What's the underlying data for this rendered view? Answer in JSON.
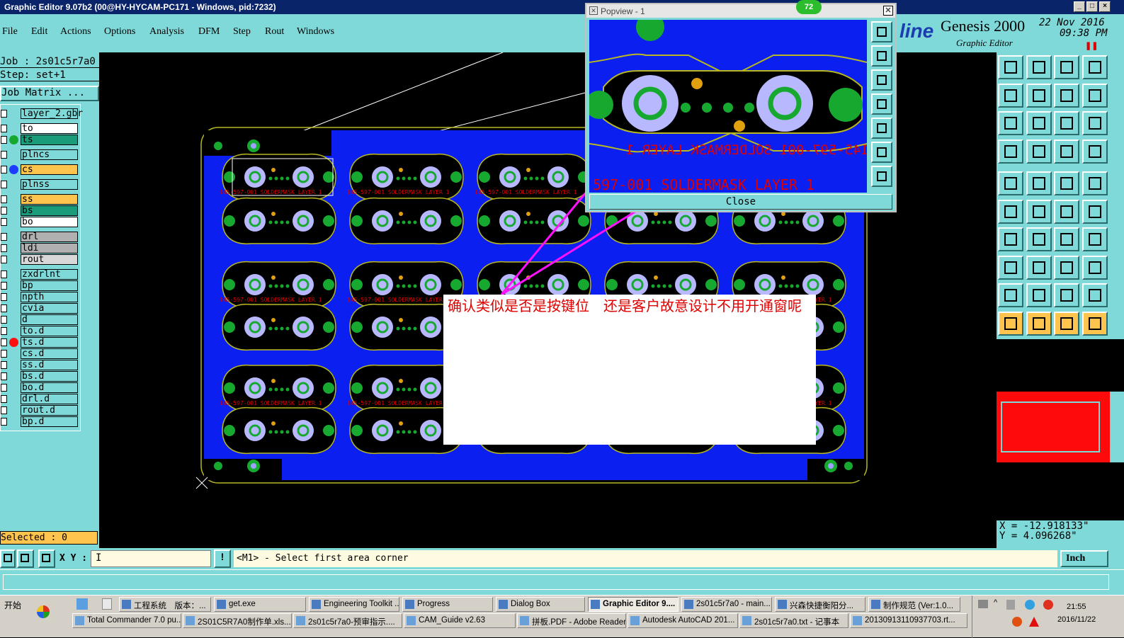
{
  "window": {
    "title": "Graphic Editor 9.07b2 (00@HY-HYCAM-PC171 - Windows, pid:7232)",
    "min": "_",
    "max": "□",
    "close": "×"
  },
  "menu": [
    "File",
    "Edit",
    "Actions",
    "Options",
    "Analysis",
    "DFM",
    "Step",
    "Rout",
    "Windows"
  ],
  "brand": {
    "logo": "line",
    "product": "Genesis 2000",
    "subtitle": "Graphic Editor",
    "date": "22 Nov 2016",
    "time": "09:38 PM"
  },
  "job": {
    "job_line": "Job : 2s01c5r7a0",
    "step_line": "Step: set+1",
    "matrix_button": "Job Matrix ..."
  },
  "layers": [
    {
      "name": "layer_2.gbr",
      "bg": "#7fd9d9",
      "dot": ""
    },
    {
      "name": "to",
      "bg": "#ffffff",
      "dot": ""
    },
    {
      "name": "ts",
      "bg": "#1a9b7a",
      "dot": "#17a830"
    },
    {
      "name": "plncs",
      "bg": "#7fd9d9",
      "dot": ""
    },
    {
      "name": "cs",
      "bg": "#ffc44d",
      "dot": "#1e3cff"
    },
    {
      "name": "plnss",
      "bg": "#7fd9d9",
      "dot": ""
    },
    {
      "name": "ss",
      "bg": "#ffc44d",
      "dot": ""
    },
    {
      "name": "bs",
      "bg": "#1a9b7a",
      "dot": ""
    },
    {
      "name": "bo",
      "bg": "#ffffff",
      "dot": ""
    },
    {
      "name": "drl",
      "bg": "#b0b0b0",
      "dot": ""
    },
    {
      "name": "ldi",
      "bg": "#b0b0b0",
      "dot": ""
    },
    {
      "name": "rout",
      "bg": "#d8d8d8",
      "dot": ""
    },
    {
      "name": "zxdrlnt",
      "bg": "#7fd9d9",
      "dot": ""
    },
    {
      "name": "bp",
      "bg": "#7fd9d9",
      "dot": ""
    },
    {
      "name": "npth",
      "bg": "#7fd9d9",
      "dot": ""
    },
    {
      "name": "cvia",
      "bg": "#7fd9d9",
      "dot": ""
    },
    {
      "name": "d",
      "bg": "#7fd9d9",
      "dot": ""
    },
    {
      "name": "to.d",
      "bg": "#7fd9d9",
      "dot": ""
    },
    {
      "name": "ts.d",
      "bg": "#7fd9d9",
      "dot": "#ff1010"
    },
    {
      "name": "cs.d",
      "bg": "#7fd9d9",
      "dot": ""
    },
    {
      "name": "ss.d",
      "bg": "#7fd9d9",
      "dot": ""
    },
    {
      "name": "bs.d",
      "bg": "#7fd9d9",
      "dot": ""
    },
    {
      "name": "bo.d",
      "bg": "#7fd9d9",
      "dot": ""
    },
    {
      "name": "drl.d",
      "bg": "#7fd9d9",
      "dot": ""
    },
    {
      "name": "rout.d",
      "bg": "#7fd9d9",
      "dot": ""
    },
    {
      "name": "bp.d",
      "bg": "#7fd9d9",
      "dot": ""
    }
  ],
  "selected": "Selected : 0",
  "popup": {
    "title": "Popview - 1",
    "badge": "72",
    "close_label": "Close",
    "top_mask_text": "597-001 SOLDERMASK LAYER 1",
    "mirror_text": "145-597-001 SOLDERMASK LAYER 1"
  },
  "board": {
    "small_text": "145-597-001 SOLDERMASK LAYER 1"
  },
  "note": {
    "text": "确认类似是否是按键位　还是客户故意设计不用开通窗呢"
  },
  "coords": {
    "x": "X = -12.918133\"",
    "y": "Y = 4.096268\""
  },
  "command": {
    "xy_label": "X Y :",
    "xy_value": "I",
    "prompt": "<M1> - Select first area corner",
    "units": "Inch"
  },
  "taskbar": {
    "start": "开始",
    "row1": [
      "工程系统　版本：...",
      "get.exe",
      "Engineering Toolkit ...",
      "Progress",
      "Dialog Box",
      "Graphic Editor 9....",
      "2s01c5r7a0 - main...",
      "兴森快捷衡阳分...",
      "制作规范 (Ver:1.0..."
    ],
    "row2": [
      "Total Commander 7.0 pu...",
      "2S01C5R7A0制作单.xls...",
      "2s01c5r7a0-预审指示....",
      "CAM_Guide v2.63",
      "拼板.PDF - Adobe Reader",
      "Autodesk AutoCAD 201...",
      "2s01c5r7a0.txt - 记事本",
      "20130913110937703.rt..."
    ],
    "clock_time": "21:55",
    "clock_date": "2016/11/22"
  }
}
